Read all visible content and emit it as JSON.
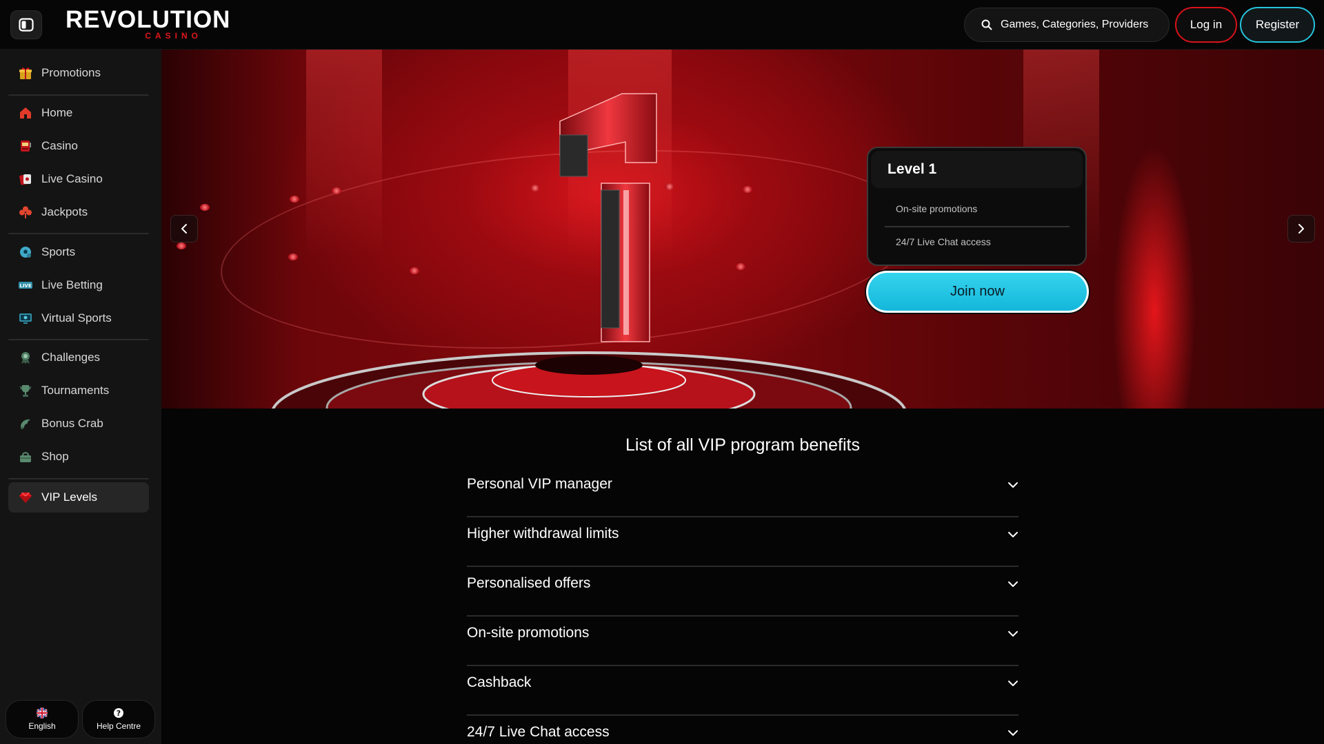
{
  "header": {
    "logo_main": "REVOLUTION",
    "logo_sub": "CASINO",
    "search_placeholder": "Games, Categories, Providers",
    "login_label": "Log in",
    "register_label": "Register"
  },
  "sidebar": {
    "promotions": "Promotions",
    "home": "Home",
    "casino": "Casino",
    "live_casino": "Live Casino",
    "jackpots": "Jackpots",
    "sports": "Sports",
    "live_betting": "Live Betting",
    "virtual_sports": "Virtual Sports",
    "challenges": "Challenges",
    "tournaments": "Tournaments",
    "bonus_crab": "Bonus Crab",
    "shop": "Shop",
    "vip_levels": "VIP Levels",
    "language": "English",
    "help": "Help Centre"
  },
  "hero": {
    "level_title": "Level 1",
    "benefits": [
      "On-site promotions",
      "24/7 Live Chat access"
    ],
    "join_label": "Join now"
  },
  "benefits": {
    "title": "List of all VIP program benefits",
    "items": [
      "Personal VIP manager",
      "Higher withdrawal limits",
      "Personalised offers",
      "On-site promotions",
      "Cashback",
      "24/7 Live Chat access"
    ]
  },
  "colors": {
    "brand_red": "#e3161b",
    "accent_cyan": "#26c4dc",
    "background": "#050505",
    "sidebar": "#141414"
  }
}
